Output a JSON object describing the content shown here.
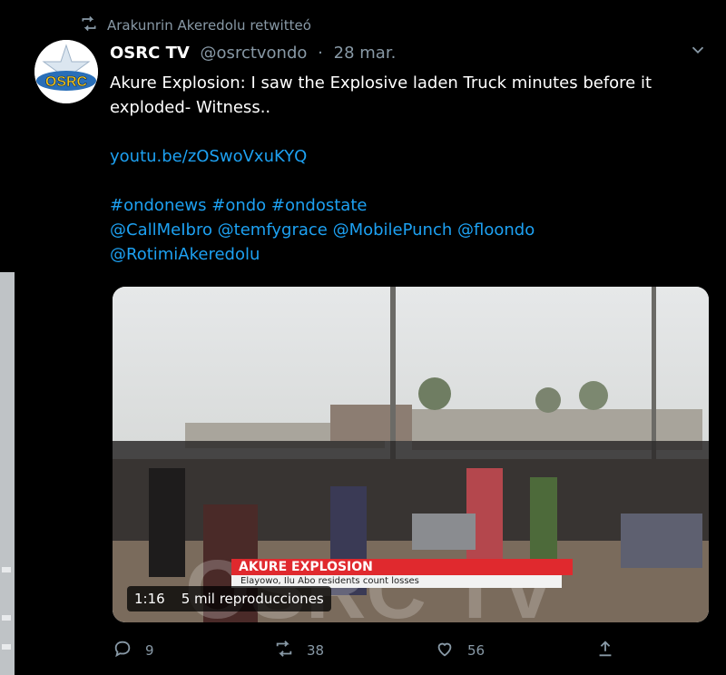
{
  "retweet": {
    "label": "Arakunrin Akeredolu retwitteó"
  },
  "tweet": {
    "avatar_label": "OSRC",
    "name": "OSRC TV",
    "handle": "@osrctvondo",
    "separator": "·",
    "date": "28 mar.",
    "text_line1": "Akure Explosion: I saw the Explosive laden Truck minutes before it",
    "text_line2": "exploded- Witness..",
    "link": "youtu.be/zOSwoVxuKYQ",
    "hashtags": "#ondonews #ondo #ondostate",
    "mentions_line1": "@CallMeIbro @temfygrace @MobilePunch @floondo",
    "mentions_line2": "@RotimiAkeredolu"
  },
  "video": {
    "banner_title": "AKURE EXPLOSION",
    "banner_subtitle": "Elayowo, Ilu Abo residents count losses",
    "watermark": "OSRC TV",
    "duration": "1:16",
    "views": "5 mil reproducciones"
  },
  "actions": {
    "reply_count": "9",
    "retweet_count": "38",
    "like_count": "56"
  },
  "colors": {
    "background": "#000000",
    "link": "#1da1f2",
    "muted": "#8899a6",
    "banner": "#e0292e"
  },
  "icons": [
    "retweet-icon",
    "chevron-down-icon",
    "reply-icon",
    "like-icon",
    "share-icon"
  ]
}
